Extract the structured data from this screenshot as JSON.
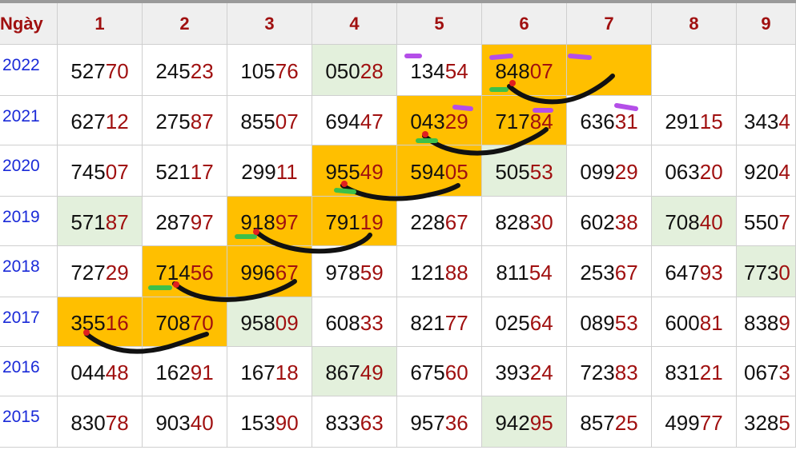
{
  "header": {
    "day_label": "Ngày",
    "columns": [
      "1",
      "2",
      "3",
      "4",
      "5",
      "6",
      "7",
      "8",
      "9"
    ]
  },
  "rows": [
    {
      "year": "2022",
      "cells": [
        {
          "head": "527",
          "tail": "70",
          "hl": ""
        },
        {
          "head": "245",
          "tail": "23",
          "hl": ""
        },
        {
          "head": "105",
          "tail": "76",
          "hl": ""
        },
        {
          "head": "050",
          "tail": "28",
          "hl": "green"
        },
        {
          "head": "134",
          "tail": "54",
          "hl": ""
        },
        {
          "head": "848",
          "tail": "07",
          "hl": "orange"
        },
        {
          "head": "",
          "tail": "",
          "hl": "orange"
        },
        {
          "head": "",
          "tail": "",
          "hl": ""
        },
        {
          "head": "",
          "tail": "",
          "hl": ""
        }
      ]
    },
    {
      "year": "2021",
      "cells": [
        {
          "head": "627",
          "tail": "12",
          "hl": ""
        },
        {
          "head": "275",
          "tail": "87",
          "hl": ""
        },
        {
          "head": "855",
          "tail": "07",
          "hl": ""
        },
        {
          "head": "694",
          "tail": "47",
          "hl": ""
        },
        {
          "head": "043",
          "tail": "29",
          "hl": "orange"
        },
        {
          "head": "717",
          "tail": "84",
          "hl": "orange"
        },
        {
          "head": "636",
          "tail": "31",
          "hl": ""
        },
        {
          "head": "291",
          "tail": "15",
          "hl": ""
        },
        {
          "head": "343",
          "tail": "4",
          "hl": ""
        }
      ]
    },
    {
      "year": "2020",
      "cells": [
        {
          "head": "745",
          "tail": "07",
          "hl": ""
        },
        {
          "head": "521",
          "tail": "17",
          "hl": ""
        },
        {
          "head": "299",
          "tail": "11",
          "hl": ""
        },
        {
          "head": "955",
          "tail": "49",
          "hl": "orange"
        },
        {
          "head": "594",
          "tail": "05",
          "hl": "orange"
        },
        {
          "head": "505",
          "tail": "53",
          "hl": "green"
        },
        {
          "head": "099",
          "tail": "29",
          "hl": ""
        },
        {
          "head": "063",
          "tail": "20",
          "hl": ""
        },
        {
          "head": "920",
          "tail": "4",
          "hl": ""
        }
      ]
    },
    {
      "year": "2019",
      "cells": [
        {
          "head": "571",
          "tail": "87",
          "hl": "green"
        },
        {
          "head": "287",
          "tail": "97",
          "hl": ""
        },
        {
          "head": "918",
          "tail": "97",
          "hl": "orange"
        },
        {
          "head": "791",
          "tail": "19",
          "hl": "orange"
        },
        {
          "head": "228",
          "tail": "67",
          "hl": ""
        },
        {
          "head": "828",
          "tail": "30",
          "hl": ""
        },
        {
          "head": "602",
          "tail": "38",
          "hl": ""
        },
        {
          "head": "708",
          "tail": "40",
          "hl": "green"
        },
        {
          "head": "550",
          "tail": "7",
          "hl": ""
        }
      ]
    },
    {
      "year": "2018",
      "cells": [
        {
          "head": "727",
          "tail": "29",
          "hl": ""
        },
        {
          "head": "714",
          "tail": "56",
          "hl": "orange"
        },
        {
          "head": "996",
          "tail": "67",
          "hl": "orange"
        },
        {
          "head": "978",
          "tail": "59",
          "hl": ""
        },
        {
          "head": "121",
          "tail": "88",
          "hl": ""
        },
        {
          "head": "811",
          "tail": "54",
          "hl": ""
        },
        {
          "head": "253",
          "tail": "67",
          "hl": ""
        },
        {
          "head": "647",
          "tail": "93",
          "hl": ""
        },
        {
          "head": "773",
          "tail": "0",
          "hl": "green"
        }
      ]
    },
    {
      "year": "2017",
      "cells": [
        {
          "head": "355",
          "tail": "16",
          "hl": "orange"
        },
        {
          "head": "708",
          "tail": "70",
          "hl": "orange"
        },
        {
          "head": "958",
          "tail": "09",
          "hl": "green"
        },
        {
          "head": "608",
          "tail": "33",
          "hl": ""
        },
        {
          "head": "821",
          "tail": "77",
          "hl": ""
        },
        {
          "head": "025",
          "tail": "64",
          "hl": ""
        },
        {
          "head": "089",
          "tail": "53",
          "hl": ""
        },
        {
          "head": "600",
          "tail": "81",
          "hl": ""
        },
        {
          "head": "838",
          "tail": "9",
          "hl": ""
        }
      ]
    },
    {
      "year": "2016",
      "cells": [
        {
          "head": "044",
          "tail": "48",
          "hl": ""
        },
        {
          "head": "162",
          "tail": "91",
          "hl": ""
        },
        {
          "head": "167",
          "tail": "18",
          "hl": ""
        },
        {
          "head": "867",
          "tail": "49",
          "hl": "green"
        },
        {
          "head": "675",
          "tail": "60",
          "hl": ""
        },
        {
          "head": "393",
          "tail": "24",
          "hl": ""
        },
        {
          "head": "723",
          "tail": "83",
          "hl": ""
        },
        {
          "head": "831",
          "tail": "21",
          "hl": ""
        },
        {
          "head": "067",
          "tail": "3",
          "hl": ""
        }
      ]
    },
    {
      "year": "2015",
      "cells": [
        {
          "head": "830",
          "tail": "78",
          "hl": ""
        },
        {
          "head": "903",
          "tail": "40",
          "hl": ""
        },
        {
          "head": "153",
          "tail": "90",
          "hl": ""
        },
        {
          "head": "833",
          "tail": "63",
          "hl": ""
        },
        {
          "head": "957",
          "tail": "36",
          "hl": ""
        },
        {
          "head": "942",
          "tail": "95",
          "hl": "green"
        },
        {
          "head": "857",
          "tail": "25",
          "hl": ""
        },
        {
          "head": "499",
          "tail": "77",
          "hl": ""
        },
        {
          "head": "328",
          "tail": "5",
          "hl": ""
        }
      ]
    }
  ],
  "colors": {
    "header_text": "#a01010",
    "year_text": "#1a2ad8",
    "highlight_orange": "#ffbf00",
    "highlight_green": "#e3f0dc",
    "ink_black": "#111111",
    "marker_purple": "#b44ee8",
    "marker_green": "#3cc04a",
    "marker_red": "#e02020"
  }
}
